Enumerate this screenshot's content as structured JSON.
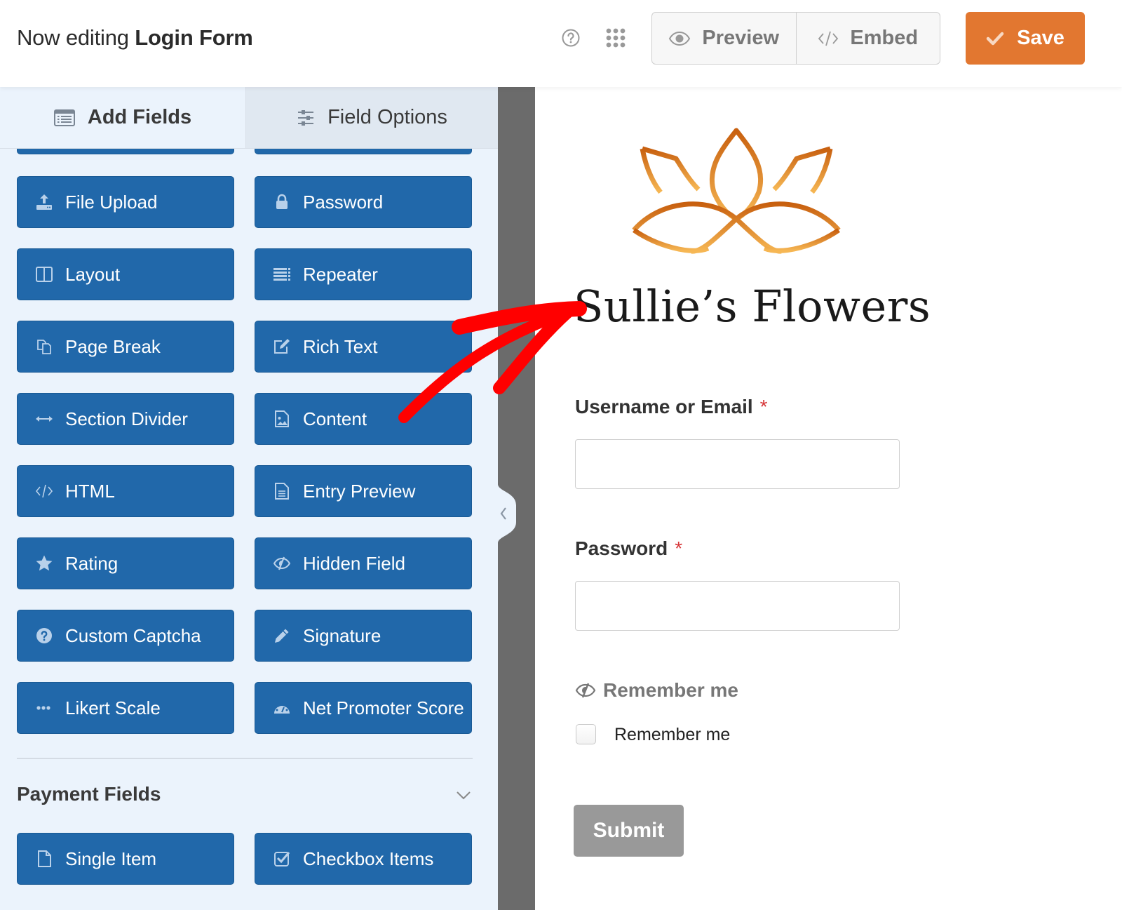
{
  "header": {
    "title_prefix": "Now editing",
    "form_name": "Login Form",
    "help_icon": "question-circle-icon",
    "apps_icon": "grid-dots-icon",
    "preview_label": "Preview",
    "embed_label": "Embed",
    "save_label": "Save"
  },
  "sidebar": {
    "tabs": [
      {
        "label": "Add Fields",
        "icon": "list-icon",
        "active": true
      },
      {
        "label": "Field Options",
        "icon": "sliders-icon",
        "active": false
      }
    ],
    "fancy_fields": [
      {
        "label": "File Upload",
        "icon": "upload-icon"
      },
      {
        "label": "Password",
        "icon": "lock-icon"
      },
      {
        "label": "Layout",
        "icon": "columns-icon"
      },
      {
        "label": "Repeater",
        "icon": "repeater-icon"
      },
      {
        "label": "Page Break",
        "icon": "copy-icon"
      },
      {
        "label": "Rich Text",
        "icon": "edit-icon"
      },
      {
        "label": "Section Divider",
        "icon": "arrows-horizontal-icon"
      },
      {
        "label": "Content",
        "icon": "image-file-icon"
      },
      {
        "label": "HTML",
        "icon": "code-icon"
      },
      {
        "label": "Entry Preview",
        "icon": "file-text-icon"
      },
      {
        "label": "Rating",
        "icon": "star-icon"
      },
      {
        "label": "Hidden Field",
        "icon": "eye-slash-icon"
      },
      {
        "label": "Custom Captcha",
        "icon": "question-circle-icon"
      },
      {
        "label": "Signature",
        "icon": "pencil-icon"
      },
      {
        "label": "Likert Scale",
        "icon": "ellipsis-icon"
      },
      {
        "label": "Net Promoter Score",
        "icon": "gauge-icon"
      }
    ],
    "payment_section": {
      "title": "Payment Fields",
      "fields": [
        {
          "label": "Single Item",
          "icon": "file-icon"
        },
        {
          "label": "Checkbox Items",
          "icon": "check-square-icon"
        }
      ]
    }
  },
  "form": {
    "brand_name": "Sullie’s Flowers",
    "fields": [
      {
        "label": "Username or Email",
        "required_mark": "*",
        "value": ""
      },
      {
        "label": "Password",
        "required_mark": "*",
        "value": ""
      }
    ],
    "remember_label": "Remember me",
    "remember_checkbox_label": "Remember me",
    "remember_checked": false,
    "submit_label": "Submit"
  },
  "colors": {
    "accent_orange": "#e27730",
    "field_button_blue": "#2168aa",
    "sidebar_bg": "#ebf3fc",
    "annotation_red": "#ff0000"
  }
}
